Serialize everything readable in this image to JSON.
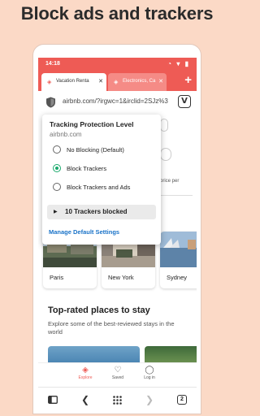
{
  "headline": "Block ads and trackers",
  "status_bar": {
    "time": "14:18",
    "icons": "◔ ▾ ▮"
  },
  "tabs": [
    {
      "label": "Vacation Renta",
      "close": "✕"
    },
    {
      "label": "Electronics, Ca",
      "close": "✕"
    }
  ],
  "new_tab": "+",
  "url_bar": {
    "url": "airbnb.com/?irgwc=1&irclid=2SJz%3",
    "logo": "V"
  },
  "popup": {
    "title": "Tracking Protection Level",
    "domain": "airbnb.com",
    "options": [
      {
        "label": "No Blocking (Default)",
        "checked": false
      },
      {
        "label": "Block Trackers",
        "checked": true
      },
      {
        "label": "Block Trackers and Ads",
        "checked": false
      }
    ],
    "trackers_blocked": "10 Trackers blocked",
    "manage_link": "Manage Default Settings"
  },
  "page": {
    "price_text": "price per",
    "cities": [
      "Paris",
      "New York",
      "Sydney"
    ],
    "section_title": "Top-rated places to stay",
    "section_desc": "Explore some of the best-reviewed stays in the world"
  },
  "app_nav": [
    {
      "label": "Explore",
      "icon": "airbnb-logo-icon",
      "active": true
    },
    {
      "label": "Saved",
      "icon": "heart-icon",
      "active": false
    },
    {
      "label": "Log in",
      "icon": "user-icon",
      "active": false
    }
  ],
  "browser_bar": {
    "tab_count": "2"
  },
  "colors": {
    "accent": "#ee5b55",
    "background": "#fbd9c6",
    "selected_radio": "#18a86b",
    "link": "#1a73c8"
  }
}
